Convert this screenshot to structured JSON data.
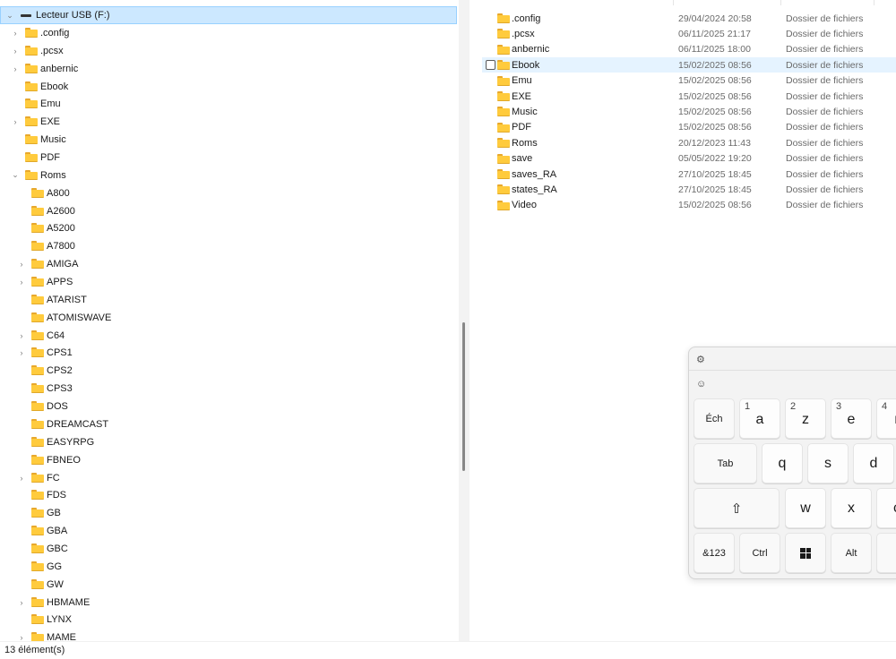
{
  "tree": {
    "root_label": "Lecteur USB (F:)",
    "items": [
      {
        "label": ".config",
        "level": 1,
        "expander": "collapsed"
      },
      {
        "label": ".pcsx",
        "level": 1,
        "expander": "collapsed"
      },
      {
        "label": "anbernic",
        "level": 1,
        "expander": "collapsed"
      },
      {
        "label": "Ebook",
        "level": 1,
        "expander": "none"
      },
      {
        "label": "Emu",
        "level": 1,
        "expander": "none"
      },
      {
        "label": "EXE",
        "level": 1,
        "expander": "collapsed"
      },
      {
        "label": "Music",
        "level": 1,
        "expander": "none"
      },
      {
        "label": "PDF",
        "level": 1,
        "expander": "none"
      },
      {
        "label": "Roms",
        "level": 1,
        "expander": "expanded"
      },
      {
        "label": "A800",
        "level": 2,
        "expander": "none"
      },
      {
        "label": "A2600",
        "level": 2,
        "expander": "none"
      },
      {
        "label": "A5200",
        "level": 2,
        "expander": "none"
      },
      {
        "label": "A7800",
        "level": 2,
        "expander": "none"
      },
      {
        "label": "AMIGA",
        "level": 2,
        "expander": "collapsed"
      },
      {
        "label": "APPS",
        "level": 2,
        "expander": "collapsed"
      },
      {
        "label": "ATARIST",
        "level": 2,
        "expander": "none"
      },
      {
        "label": "ATOMISWAVE",
        "level": 2,
        "expander": "none"
      },
      {
        "label": "C64",
        "level": 2,
        "expander": "collapsed"
      },
      {
        "label": "CPS1",
        "level": 2,
        "expander": "collapsed"
      },
      {
        "label": "CPS2",
        "level": 2,
        "expander": "none"
      },
      {
        "label": "CPS3",
        "level": 2,
        "expander": "none"
      },
      {
        "label": "DOS",
        "level": 2,
        "expander": "none"
      },
      {
        "label": "DREAMCAST",
        "level": 2,
        "expander": "none"
      },
      {
        "label": "EASYRPG",
        "level": 2,
        "expander": "none"
      },
      {
        "label": "FBNEO",
        "level": 2,
        "expander": "none"
      },
      {
        "label": "FC",
        "level": 2,
        "expander": "collapsed"
      },
      {
        "label": "FDS",
        "level": 2,
        "expander": "none"
      },
      {
        "label": "GB",
        "level": 2,
        "expander": "none"
      },
      {
        "label": "GBA",
        "level": 2,
        "expander": "none"
      },
      {
        "label": "GBC",
        "level": 2,
        "expander": "none"
      },
      {
        "label": "GG",
        "level": 2,
        "expander": "none"
      },
      {
        "label": "GW",
        "level": 2,
        "expander": "none"
      },
      {
        "label": "HBMAME",
        "level": 2,
        "expander": "collapsed"
      },
      {
        "label": "LYNX",
        "level": 2,
        "expander": "none"
      },
      {
        "label": "MAME",
        "level": 2,
        "expander": "collapsed"
      }
    ]
  },
  "list": {
    "rows": [
      {
        "name": ".config",
        "date": "29/04/2024 20:58",
        "type": "Dossier de fichiers"
      },
      {
        "name": ".pcsx",
        "date": "06/11/2025 21:17",
        "type": "Dossier de fichiers"
      },
      {
        "name": "anbernic",
        "date": "06/11/2025 18:00",
        "type": "Dossier de fichiers"
      },
      {
        "name": "Ebook",
        "date": "15/02/2025 08:56",
        "type": "Dossier de fichiers"
      },
      {
        "name": "Emu",
        "date": "15/02/2025 08:56",
        "type": "Dossier de fichiers"
      },
      {
        "name": "EXE",
        "date": "15/02/2025 08:56",
        "type": "Dossier de fichiers"
      },
      {
        "name": "Music",
        "date": "15/02/2025 08:56",
        "type": "Dossier de fichiers"
      },
      {
        "name": "PDF",
        "date": "15/02/2025 08:56",
        "type": "Dossier de fichiers"
      },
      {
        "name": "Roms",
        "date": "20/12/2023 11:43",
        "type": "Dossier de fichiers"
      },
      {
        "name": "save",
        "date": "05/05/2022 19:20",
        "type": "Dossier de fichiers"
      },
      {
        "name": "saves_RA",
        "date": "27/10/2025 18:45",
        "type": "Dossier de fichiers"
      },
      {
        "name": "states_RA",
        "date": "27/10/2025 18:45",
        "type": "Dossier de fichiers"
      },
      {
        "name": "Video",
        "date": "15/02/2025 08:56",
        "type": "Dossier de fichiers"
      }
    ]
  },
  "status": {
    "count_text": "13 élément(s)"
  },
  "keyboard": {
    "row1": [
      {
        "label": "Éch",
        "num": ""
      },
      {
        "label": "a",
        "num": "1"
      },
      {
        "label": "z",
        "num": "2"
      },
      {
        "label": "e",
        "num": "3"
      },
      {
        "label": "r",
        "num": "4"
      }
    ],
    "row2": [
      {
        "label": "Tab"
      },
      {
        "label": "q"
      },
      {
        "label": "s"
      },
      {
        "label": "d"
      }
    ],
    "row3": [
      {
        "label": "w"
      },
      {
        "label": "x"
      },
      {
        "label": "c"
      }
    ],
    "row4": [
      {
        "label": "&123"
      },
      {
        "label": "Ctrl"
      },
      {
        "label": "Alt"
      }
    ]
  },
  "icons": {
    "folder": "folder-icon",
    "drive": "usb-drive-icon",
    "settings": "gear-icon",
    "emoji": "emoji-icon",
    "shift": "shift-icon",
    "windows": "windows-icon"
  },
  "colors": {
    "selected_bg": "#cce8ff",
    "hover_bg": "#e5f3ff",
    "folder": "#ffcb3d"
  }
}
